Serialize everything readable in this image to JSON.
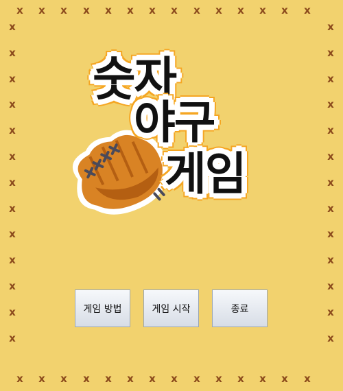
{
  "title": {
    "line1": "숫자",
    "line2": "야구",
    "line3": "게임"
  },
  "menu": {
    "how_to_play": "게임 방법",
    "start_game": "게임 시작",
    "quit": "종료"
  },
  "border": {
    "stitch_mark": "x",
    "stitch_color": "#8b4a1c"
  },
  "colors": {
    "background": "#f2d26e",
    "title_outline": "#f5a623",
    "glove": "#d98324"
  },
  "icons": {
    "logo_image": "baseball-glove-icon"
  }
}
